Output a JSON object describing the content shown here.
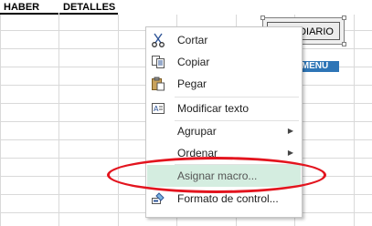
{
  "sheet": {
    "headers": [
      "HABER",
      "DETALLES"
    ]
  },
  "shape_button": {
    "label": "O DIARIO"
  },
  "menu_cell": {
    "label": "MENU"
  },
  "context_menu": {
    "items": [
      {
        "label": "Cortar",
        "icon": "scissors-icon",
        "submenu": false
      },
      {
        "label": "Copiar",
        "icon": "copy-icon",
        "submenu": false
      },
      {
        "label": "Pegar",
        "icon": "paste-icon",
        "submenu": false
      },
      {
        "label": "Modificar texto",
        "icon": "edit-text-icon",
        "submenu": false
      },
      {
        "label": "Agrupar",
        "icon": "",
        "submenu": true
      },
      {
        "label": "Ordenar",
        "icon": "",
        "submenu": true
      },
      {
        "label": "Asignar macro...",
        "icon": "",
        "submenu": false,
        "highlighted": true
      },
      {
        "label": "Formato de control...",
        "icon": "format-control-icon",
        "submenu": false
      }
    ]
  },
  "colors": {
    "menu_cell_bg": "#2e75b6",
    "highlight_bg": "#d4ede0",
    "annotation": "#e3141e"
  }
}
